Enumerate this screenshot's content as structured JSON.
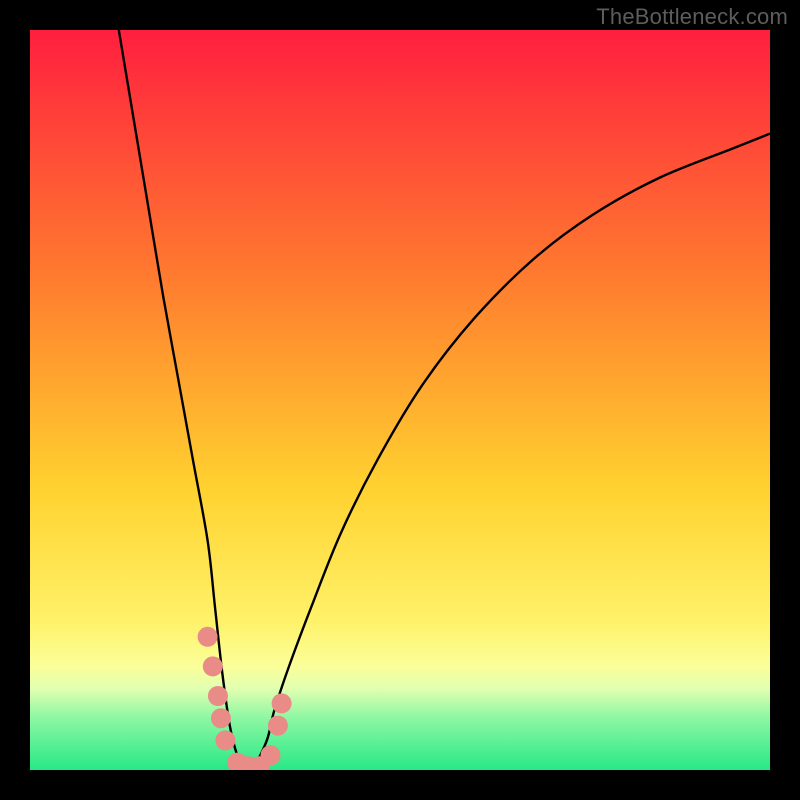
{
  "watermark": "TheBottleneck.com",
  "chart_data": {
    "type": "line",
    "title": "",
    "xlabel": "",
    "ylabel": "",
    "xlim": [
      0,
      100
    ],
    "ylim": [
      0,
      100
    ],
    "grid": false,
    "background_gradient_stops": [
      {
        "offset": 0,
        "color": "#ff1f3f"
      },
      {
        "offset": 33,
        "color": "#ff7a2f"
      },
      {
        "offset": 62,
        "color": "#ffd22f"
      },
      {
        "offset": 80,
        "color": "#fff26a"
      },
      {
        "offset": 86,
        "color": "#fbff9a"
      },
      {
        "offset": 89,
        "color": "#e0ffb0"
      },
      {
        "offset": 93,
        "color": "#8cf7a3"
      },
      {
        "offset": 100,
        "color": "#27e886"
      }
    ],
    "series": [
      {
        "name": "bottleneck-curve",
        "x": [
          12,
          14,
          16,
          18,
          20,
          22,
          24,
          25,
          26,
          27,
          28,
          29,
          30,
          32,
          33,
          35,
          38,
          42,
          47,
          53,
          60,
          68,
          76,
          85,
          95,
          100
        ],
        "values": [
          100,
          88,
          76,
          64,
          53,
          42,
          31,
          22,
          13,
          6,
          2,
          0,
          0,
          4,
          8,
          14,
          22,
          32,
          42,
          52,
          61,
          69,
          75,
          80,
          84,
          86
        ]
      }
    ],
    "markers": {
      "name": "highlight-region",
      "color": "#e98b87",
      "points": [
        {
          "x": 24.0,
          "y": 18
        },
        {
          "x": 24.7,
          "y": 14
        },
        {
          "x": 25.4,
          "y": 10
        },
        {
          "x": 25.8,
          "y": 7
        },
        {
          "x": 26.4,
          "y": 4
        },
        {
          "x": 28.0,
          "y": 1
        },
        {
          "x": 29.5,
          "y": 0.5
        },
        {
          "x": 31.0,
          "y": 0.5
        },
        {
          "x": 32.5,
          "y": 2
        },
        {
          "x": 33.5,
          "y": 6
        },
        {
          "x": 34.0,
          "y": 9
        }
      ]
    }
  }
}
